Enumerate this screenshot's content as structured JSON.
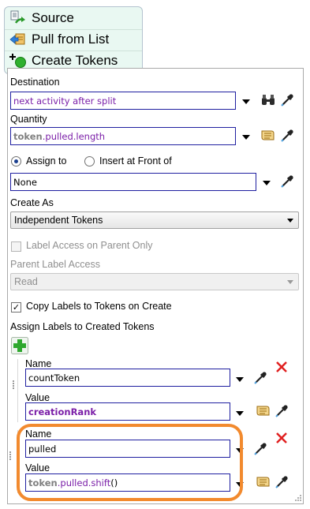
{
  "activities": [
    {
      "label": "Source",
      "icon": "source-icon"
    },
    {
      "label": "Pull from List",
      "icon": "pull-from-list-icon"
    },
    {
      "label": "Create Tokens",
      "icon": "create-tokens-icon"
    }
  ],
  "destination": {
    "label": "Destination",
    "value": "next activity after split"
  },
  "quantity": {
    "label": "Quantity",
    "token": "token",
    "rest": ".pulled.",
    "prop": "length"
  },
  "assign": {
    "assign_to": "Assign to",
    "insert_front": "Insert at Front of",
    "selected": "assign_to",
    "value": "None"
  },
  "create_as": {
    "label": "Create As",
    "value": "Independent Tokens"
  },
  "label_access": {
    "label": "Label Access on Parent Only",
    "checked": false,
    "disabled": true
  },
  "parent_label_access": {
    "label": "Parent Label Access",
    "value": "Read",
    "disabled": true
  },
  "copy_labels": {
    "label": "Copy Labels to Tokens on Create",
    "checked": true
  },
  "assign_labels": {
    "label": "Assign Labels to Created Tokens"
  },
  "label_entries": [
    {
      "name_label": "Name",
      "name_value": "countToken",
      "value_label": "Value",
      "value_value": "creationRank"
    },
    {
      "name_label": "Name",
      "name_value": "pulled",
      "value_label": "Value",
      "value_token": "token",
      "value_mid": ".pulled.",
      "value_method": "shift",
      "value_tail": "()"
    }
  ],
  "colors": {
    "accent_purple": "#7b1fa8",
    "field_border": "#1f1fa0",
    "highlight": "#f28a2e",
    "delete_red": "#e02020",
    "add_green": "#2ea82e"
  }
}
